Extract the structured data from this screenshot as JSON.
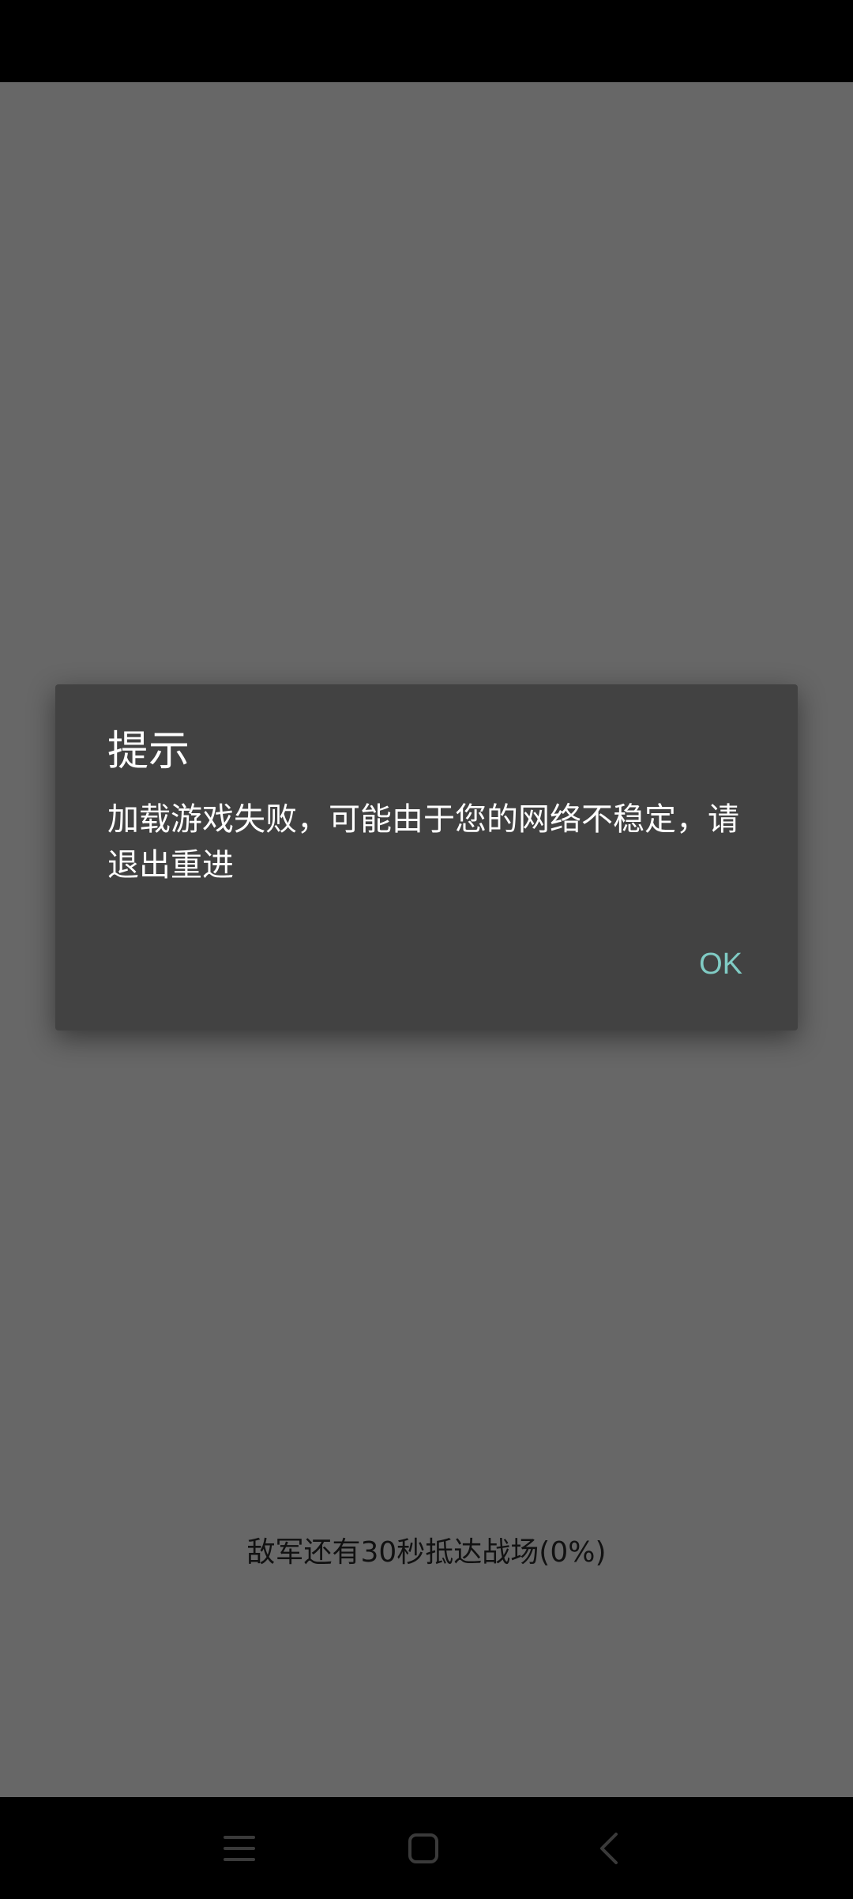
{
  "dialog": {
    "title": "提示",
    "message": "加载游戏失败，可能由于您的网络不稳定，请退出重进",
    "ok_label": "OK"
  },
  "loading": {
    "status_text": "敌军还有30秒抵达战场(0%)"
  },
  "navbar": {
    "icons": [
      "menu-icon",
      "home-icon",
      "back-icon"
    ]
  },
  "colors": {
    "background": "#676767",
    "dialog": "#424242",
    "accent": "#80cbc4"
  }
}
